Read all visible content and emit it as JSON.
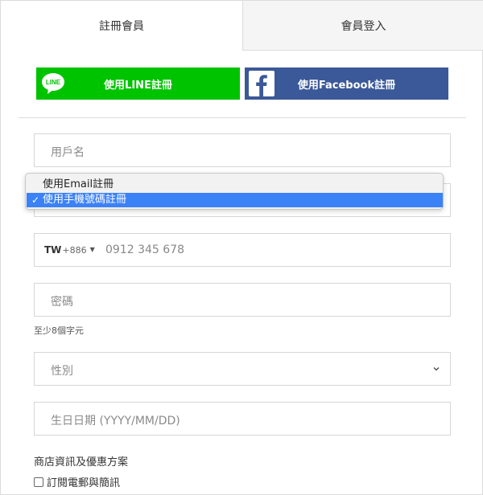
{
  "tabs": [
    {
      "label": "註冊會員",
      "active": true
    },
    {
      "label": "會員登入",
      "active": false
    }
  ],
  "social": {
    "line_label": "使用LINE註冊",
    "line_icon_text": "LINE",
    "facebook_label": "使用Facebook註冊"
  },
  "form": {
    "username_placeholder": "用戶名",
    "register_method_options": [
      "使用Email註冊",
      "使用手機號碼註冊"
    ],
    "register_method_selected": "使用手機號碼註冊",
    "check_mark": "✓",
    "phone": {
      "country": "TW",
      "dial_code": "+886",
      "placeholder": "0912 345 678"
    },
    "password_placeholder": "密碼",
    "password_hint": "至少8個字元",
    "gender_placeholder": "性別",
    "birthday_placeholder": "生日日期 (YYYY/MM/DD)",
    "newsletter_title": "商店資訊及優惠方案",
    "newsletter_checkbox_label": "訂閱電郵與簡訊"
  },
  "colors": {
    "line_green": "#00c300",
    "facebook_blue": "#3b5998",
    "select_highlight": "#3b82f6"
  }
}
